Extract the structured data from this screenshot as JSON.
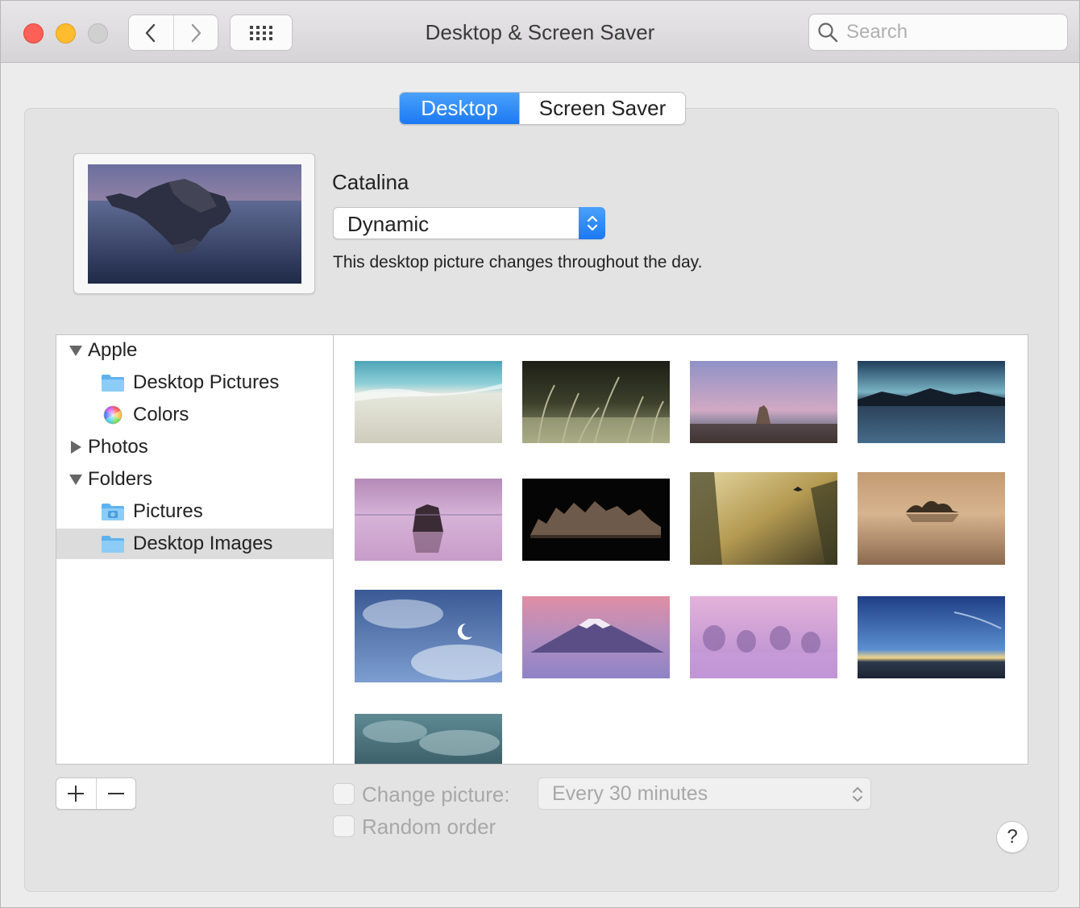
{
  "window": {
    "title": "Desktop & Screen Saver",
    "search_placeholder": "Search"
  },
  "tabs": [
    {
      "label": "Desktop",
      "selected": true
    },
    {
      "label": "Screen Saver",
      "selected": false
    }
  ],
  "current_picture": {
    "name": "Catalina",
    "mode": "Dynamic",
    "description": "This desktop picture changes throughout the day."
  },
  "sidebar": {
    "groups": [
      {
        "label": "Apple",
        "expanded": true,
        "items": [
          {
            "label": "Desktop Pictures",
            "icon": "folder-icon"
          },
          {
            "label": "Colors",
            "icon": "color-wheel-icon"
          }
        ]
      },
      {
        "label": "Photos",
        "expanded": false,
        "items": []
      },
      {
        "label": "Folders",
        "expanded": true,
        "items": [
          {
            "label": "Pictures",
            "icon": "pictures-folder-icon"
          },
          {
            "label": "Desktop Images",
            "icon": "folder-icon",
            "selected": true
          }
        ]
      }
    ]
  },
  "thumbnails": [
    {
      "name": "beach-wave"
    },
    {
      "name": "grass-plumes"
    },
    {
      "name": "desert-rock-dusk"
    },
    {
      "name": "lake-night-mountains"
    },
    {
      "name": "pink-lake-rock"
    },
    {
      "name": "tufa-towers-night"
    },
    {
      "name": "golden-cliffs-bird"
    },
    {
      "name": "misty-island"
    },
    {
      "name": "moon-clouds"
    },
    {
      "name": "mount-fuji-pink"
    },
    {
      "name": "purple-fog-trees"
    },
    {
      "name": "blue-sky-horizon"
    },
    {
      "name": "cloudy-sky-teal"
    }
  ],
  "controls": {
    "add_label": "+",
    "remove_label": "−",
    "change_picture_label": "Change picture:",
    "change_picture_checked": false,
    "interval": "Every 30 minutes",
    "random_order_label": "Random order",
    "random_order_checked": false,
    "help_label": "?"
  },
  "colors": {
    "accent": "#1c79f3",
    "close": "#fe5f57",
    "minimize": "#febc2e"
  }
}
